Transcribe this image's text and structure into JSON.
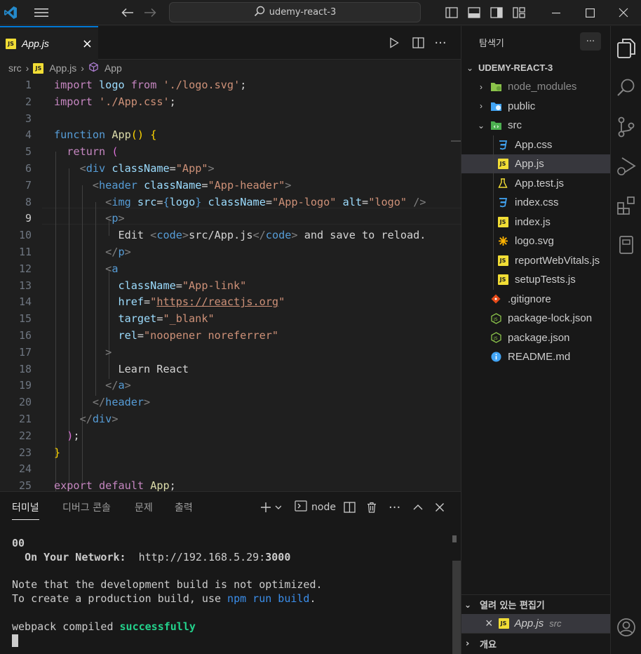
{
  "titlebar": {
    "search_text": "udemy-react-3"
  },
  "editor": {
    "active_tab": "App.js",
    "breadcrumb": {
      "folder": "src",
      "file": "App.js",
      "symbol": "App"
    },
    "current_line": 9,
    "line_numbers": [
      "1",
      "2",
      "3",
      "4",
      "5",
      "6",
      "7",
      "8",
      "9",
      "10",
      "11",
      "12",
      "13",
      "14",
      "15",
      "16",
      "17",
      "18",
      "19",
      "20",
      "21",
      "22",
      "23",
      "24",
      "25"
    ]
  },
  "panel": {
    "tabs": [
      "터미널",
      "디버그 콘솔",
      "문제",
      "출력"
    ],
    "active_tab": "터미널",
    "terminal_profile": "node",
    "terminal": {
      "line1": "00",
      "network_label": "On Your Network:",
      "network_url_prefix": "http://192.168.5.29:",
      "network_port": "3000",
      "note1": "Note that the development build is not optimized.",
      "note2_prefix": "To create a production build, use ",
      "note2_cmd": "npm run build",
      "note2_suffix": ".",
      "compiled_prefix": "webpack compiled ",
      "compiled_status": "successfully"
    }
  },
  "explorer": {
    "title": "탐색기",
    "root": "UDEMY-REACT-3",
    "items": [
      {
        "label": "node_modules",
        "kind": "folder-node"
      },
      {
        "label": "public",
        "kind": "folder-public"
      },
      {
        "label": "src",
        "kind": "folder-src"
      },
      {
        "label": "App.css",
        "kind": "css"
      },
      {
        "label": "App.js",
        "kind": "js"
      },
      {
        "label": "App.test.js",
        "kind": "test"
      },
      {
        "label": "index.css",
        "kind": "css"
      },
      {
        "label": "index.js",
        "kind": "js"
      },
      {
        "label": "logo.svg",
        "kind": "svg"
      },
      {
        "label": "reportWebVitals.js",
        "kind": "js"
      },
      {
        "label": "setupTests.js",
        "kind": "js"
      },
      {
        "label": ".gitignore",
        "kind": "git"
      },
      {
        "label": "package-lock.json",
        "kind": "node"
      },
      {
        "label": "package.json",
        "kind": "node"
      },
      {
        "label": "README.md",
        "kind": "info"
      }
    ],
    "open_editors_title": "열려 있는 편집기",
    "open_editor": {
      "file": "App.js",
      "folder": "src"
    },
    "outline_title": "개요"
  },
  "colors": {
    "accent": "#0078d4",
    "js_badge": "#f1dd35",
    "css_icon": "#42a5f5",
    "success": "#23d18b"
  }
}
